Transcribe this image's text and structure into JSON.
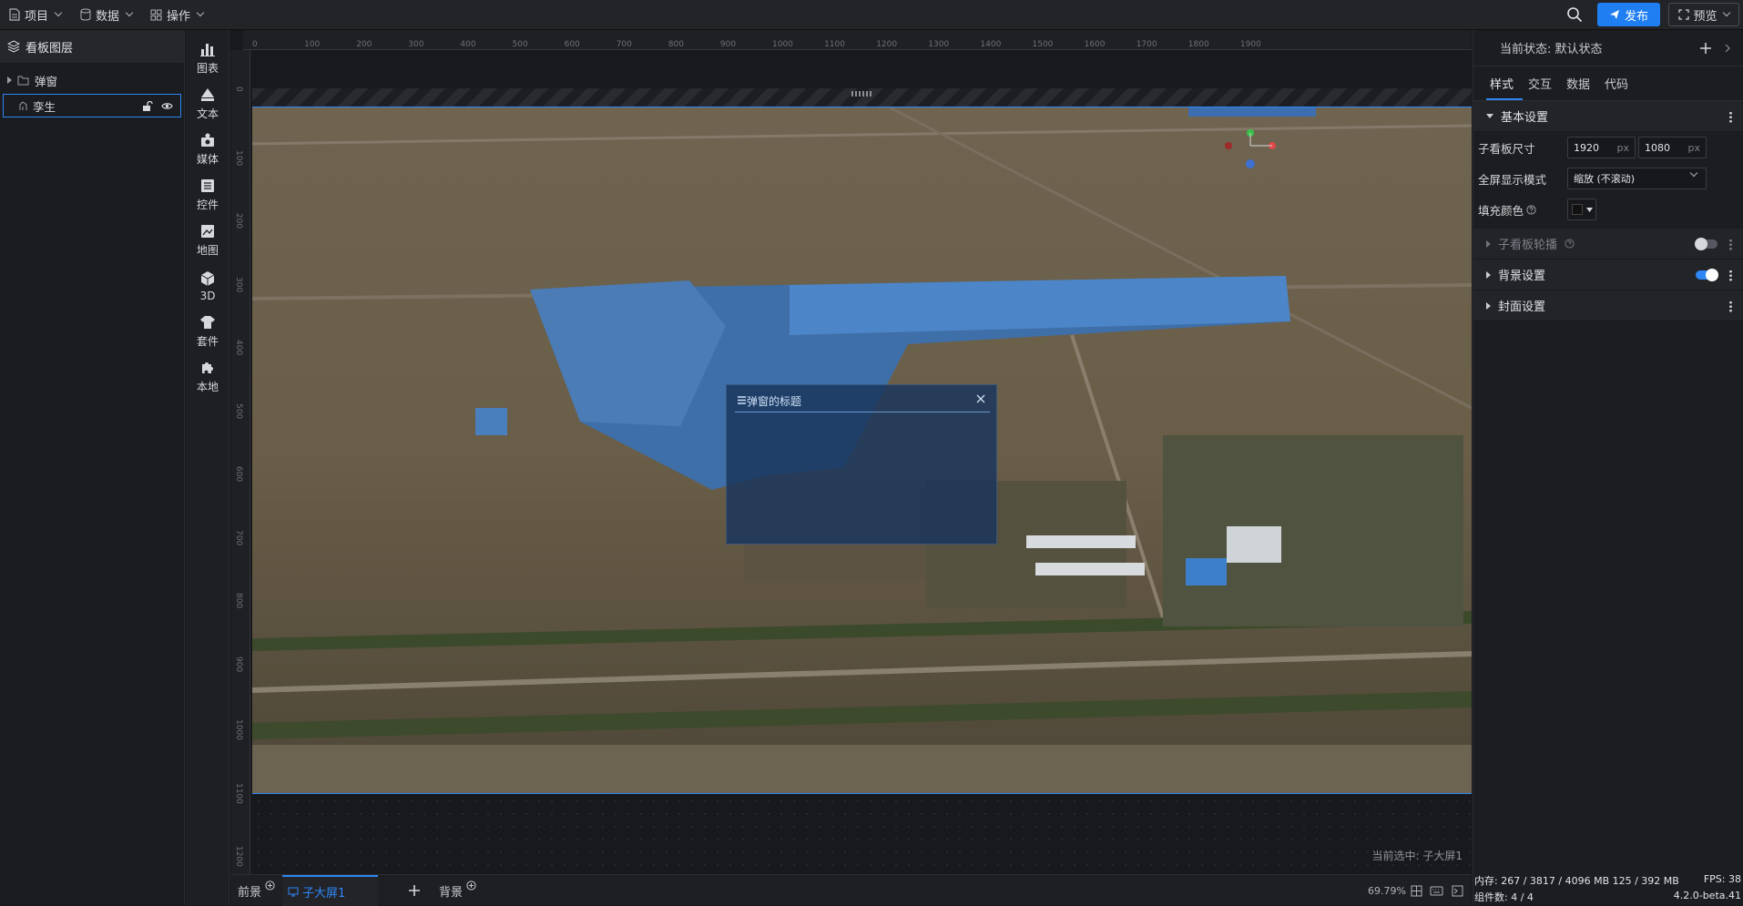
{
  "topbar": {
    "menus": [
      {
        "label": "项目",
        "icon": "file-icon"
      },
      {
        "label": "数据",
        "icon": "database-icon"
      },
      {
        "label": "操作",
        "icon": "grid-icon"
      }
    ],
    "publish_label": "发布",
    "preview_label": "预览",
    "colors": {
      "primary": "#1f7ef2",
      "bg": "#232428"
    }
  },
  "layers": {
    "title": "看板图层",
    "items": [
      {
        "label": "弹窗",
        "icon": "folder-icon"
      },
      {
        "label": "孪生",
        "icon": "twin-icon"
      }
    ]
  },
  "tools": [
    {
      "label": "图表",
      "icon": "chart-icon"
    },
    {
      "label": "文本",
      "icon": "text-icon"
    },
    {
      "label": "媒体",
      "icon": "media-icon"
    },
    {
      "label": "控件",
      "icon": "widget-icon"
    },
    {
      "label": "地图",
      "icon": "map-icon"
    },
    {
      "label": "3D",
      "icon": "cube-icon"
    },
    {
      "label": "套件",
      "icon": "kit-icon"
    },
    {
      "label": "本地",
      "icon": "puzzle-icon"
    }
  ],
  "ruler": {
    "top": [
      "0",
      "100",
      "200",
      "300",
      "400",
      "500",
      "600",
      "700",
      "800",
      "900",
      "1000",
      "1100",
      "1200",
      "1300",
      "1400",
      "1500",
      "1600",
      "1700",
      "1800",
      "1900"
    ],
    "left": [
      "0",
      "100",
      "200",
      "300",
      "400",
      "500",
      "600",
      "700",
      "800",
      "900",
      "1000",
      "1100",
      "1200"
    ]
  },
  "canvas": {
    "popup_title": "弹窗的标题",
    "selected_label": "当前选中: 子大屏1"
  },
  "tabbar": {
    "front_label": "前景",
    "screen_label": "子大屏1",
    "back_label": "背景",
    "zoom": "69.79%"
  },
  "props": {
    "state_label": "当前状态: 默认状态",
    "tabs": [
      "样式",
      "交互",
      "数据",
      "代码"
    ],
    "basic_section": "基本设置",
    "size_label": "子看板尺寸",
    "width": "1920",
    "height": "1080",
    "unit": "px",
    "fullscreen_label": "全屏显示模式",
    "fullscreen_value": "缩放 (不滚动)",
    "fill_label": "填充颜色",
    "carousel_section": "子看板轮播",
    "carousel_on": false,
    "bg_section": "背景设置",
    "bg_on": true,
    "cover_section": "封面设置",
    "accent": "#2f86f6"
  },
  "status": {
    "memory": "内存: 267 / 3817 / 4096 MB  125 / 392 MB",
    "fps": "FPS: 38",
    "components": "组件数: 4 / 4",
    "version": "4.2.0-beta.41"
  }
}
